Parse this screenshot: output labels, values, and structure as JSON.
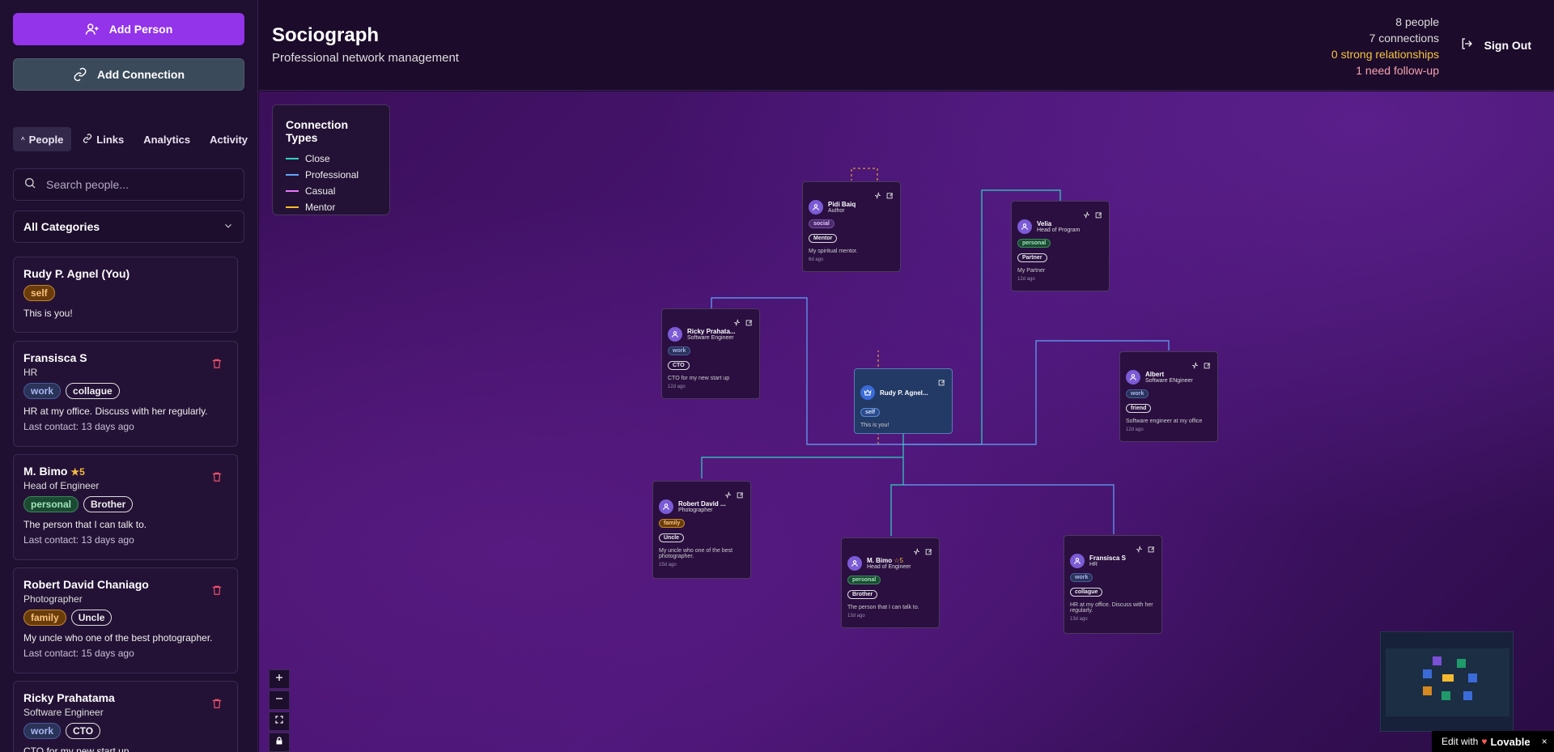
{
  "sidebar": {
    "add_person": "Add Person",
    "add_connection": "Add Connection",
    "tabs": [
      {
        "label": "People",
        "icon": "chevron-up-icon"
      },
      {
        "label": "Links",
        "icon": "link-icon"
      },
      {
        "label": "Analytics"
      },
      {
        "label": "Activity"
      }
    ],
    "search_placeholder": "Search people...",
    "category": "All Categories",
    "people": [
      {
        "name": "Rudy P. Agnel (You)",
        "tags": [
          "self"
        ],
        "note": "This is you!"
      },
      {
        "name": "Fransisca S",
        "role": "HR",
        "tags": [
          "work",
          "collague"
        ],
        "note": "HR at my office. Discuss with her regularly.",
        "last_contact": "Last contact: 13 days ago"
      },
      {
        "name": "M. Bimo",
        "stars": "★5",
        "role": "Head of Engineer",
        "tags": [
          "personal",
          "Brother"
        ],
        "note": "The person that I can talk to.",
        "last_contact": "Last contact: 13 days ago"
      },
      {
        "name": "Robert David Chaniago",
        "role": "Photographer",
        "tags": [
          "family",
          "Uncle"
        ],
        "note": "My uncle who one of the best photographer.",
        "last_contact": "Last contact: 15 days ago"
      },
      {
        "name": "Ricky Prahatama",
        "role": "Software Engineer",
        "tags": [
          "work",
          "CTO"
        ],
        "note": "CTO for my new start up"
      }
    ]
  },
  "header": {
    "title": "Sociograph",
    "subtitle": "Professional network management",
    "stats": {
      "people": "8 people",
      "connections": "7 connections",
      "strong": "0 strong relationships",
      "followup": "1 need follow-up"
    },
    "sign_out": "Sign Out"
  },
  "legend": {
    "title": "Connection Types",
    "items": [
      {
        "label": "Close",
        "color": "#2dd4bf"
      },
      {
        "label": "Professional",
        "color": "#60a5fa"
      },
      {
        "label": "Casual",
        "color": "#e879f9"
      },
      {
        "label": "Mentor",
        "color": "#fbbf24"
      }
    ]
  },
  "nodes": {
    "pidi": {
      "name": "Pidi Baiq",
      "role": "Author",
      "tag1": "social",
      "tag2": "Mentor",
      "note": "My spiritual mentor.",
      "last": "6d ago"
    },
    "velia": {
      "name": "Velia",
      "role": "Head of Program",
      "tag1": "personal",
      "tag2": "Partner",
      "note": "My Partner",
      "last": "12d ago"
    },
    "ricky": {
      "name": "Ricky Prahata...",
      "role": "Software Engineer",
      "tag1": "work",
      "tag2": "CTO",
      "note": "CTO for my new start up",
      "last": "12d ago"
    },
    "rudy": {
      "name": "Rudy P. Agnel...",
      "tag1": "self",
      "note": "This is you!"
    },
    "albert": {
      "name": "Albert",
      "role": "Software ENgineer",
      "tag1": "work",
      "tag2": "friend",
      "note": "Software engineer at my office",
      "last": "12d ago"
    },
    "robert": {
      "name": "Robert David ...",
      "role": "Photographer",
      "tag1": "family",
      "tag2": "Uncle",
      "note": "My uncle who one of the best photographer.",
      "last": "15d ago"
    },
    "bimo": {
      "name": "M. Bimo",
      "stars": "☆5",
      "role": "Head of Engineer",
      "tag1": "personal",
      "tag2": "Brother",
      "note": "The person that I can talk to.",
      "last": "13d ago"
    },
    "fransisca": {
      "name": "Fransisca S",
      "role": "HR",
      "tag1": "work",
      "tag2": "collague",
      "note": "HR at my office. Discuss with her regularly.",
      "last": "13d ago"
    }
  },
  "footer": {
    "edit_with": "Edit with",
    "brand": "Lovable"
  }
}
